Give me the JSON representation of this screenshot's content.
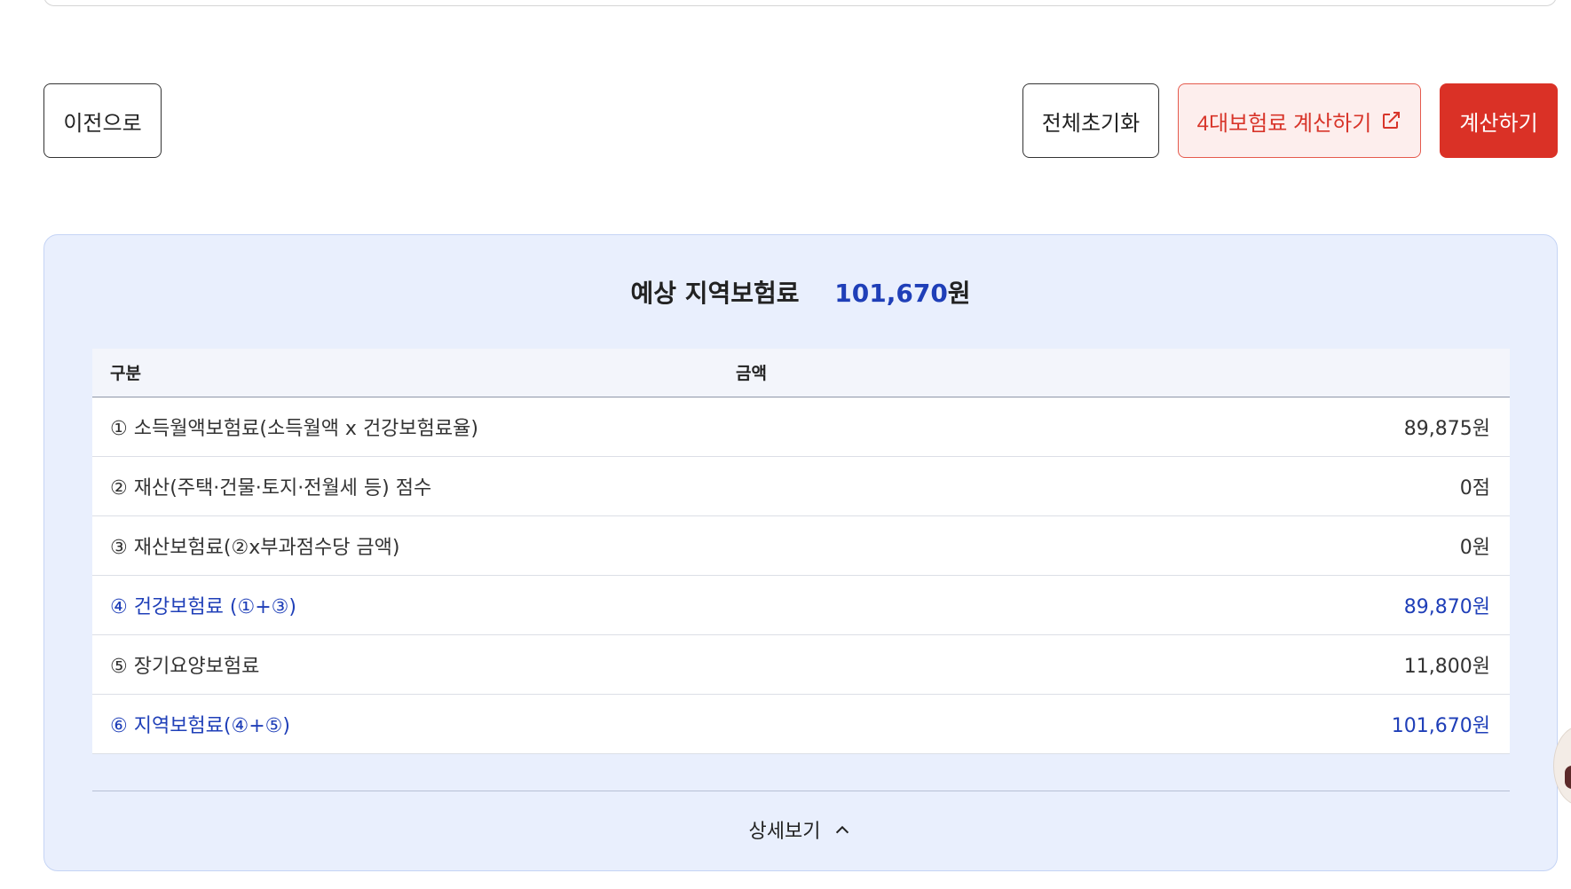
{
  "actions": {
    "prev_label": "이전으로",
    "reset_label": "전체초기화",
    "insurance_calc_label": "4대보험료 계산하기",
    "calc_label": "계산하기"
  },
  "result": {
    "title": "예상 지역보험료",
    "amount": "101,670",
    "amount_unit": "원",
    "columns": [
      "구분",
      "금액"
    ],
    "rows": [
      {
        "label": "① 소득월액보험료(소득월액 x 건강보험료율)",
        "value": "89,875원"
      },
      {
        "label": "② 재산(주택·건물·토지·전월세 등) 점수",
        "value": "0점"
      },
      {
        "label": "③ 재산보험료(②x부과점수당 금액)",
        "value": "0원"
      },
      {
        "label": "④ 건강보험료 (①+③)",
        "value": "89,870원"
      },
      {
        "label": "⑤ 장기요양보험료",
        "value": "11,800원"
      },
      {
        "label": "⑥ 지역보험료(④+⑤)",
        "value": "101,670원"
      }
    ],
    "detail_toggle_label": "상세보기"
  },
  "colors": {
    "accent_red": "#da3126",
    "accent_blue": "#1f3fb8",
    "panel_bg": "#e9effd"
  },
  "icons": {
    "external_link": "external-link-icon",
    "chevron_up": "chevron-up-icon"
  }
}
